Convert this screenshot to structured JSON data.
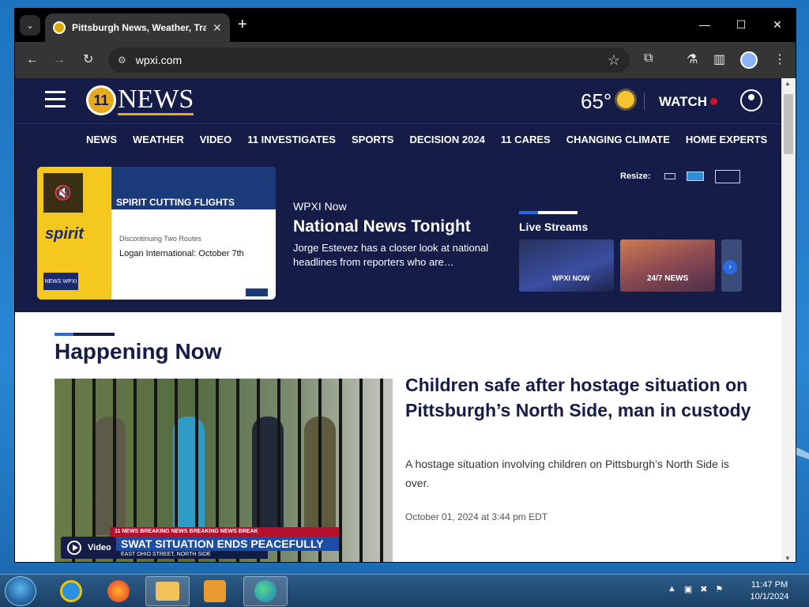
{
  "browser": {
    "tab_title": "Pittsburgh News, Weather, Tra",
    "tab_close": "✕",
    "new_tab": "+",
    "url": "wpxi.com",
    "window_min": "—",
    "window_max": "☐",
    "window_close": "✕",
    "tab_list": "⌄"
  },
  "site": {
    "logo_text": "NEWS",
    "logo_mark": "11",
    "temperature": "65°",
    "watch_label": "WATCH",
    "nav": [
      "NEWS",
      "WEATHER",
      "VIDEO",
      "11 INVESTIGATES",
      "SPORTS",
      "DECISION 2024",
      "11 CARES",
      "CHANGING CLIMATE",
      "HOME EXPERTS"
    ]
  },
  "promo": {
    "title": "SPIRIT CUTTING FLIGHTS",
    "brand": "spirit",
    "line1": "Discontinuing Two Routes",
    "line2": "Logan International: October 7th",
    "badge": "NEWS WPXI"
  },
  "now": {
    "kicker": "WPXI Now",
    "title": "National News Tonight",
    "desc": "Jorge Estevez has a closer look at national headlines from reporters who are…"
  },
  "resize_label": "Resize:",
  "live_streams": {
    "heading": "Live Streams",
    "thumb1_label": "WPXI NOW",
    "thumb2_label": "24/7 NEWS",
    "next": "›"
  },
  "happening": {
    "heading": "Happening Now",
    "headline": "Children safe after hostage situation on Pittsburgh’s North Side, man in custody",
    "description": "A hostage situation involving children on Pittsburgh’s North Side is over.",
    "date": "October 01, 2024 at 3:44 pm EDT",
    "video_label": "Video",
    "ticker_top": "11 NEWS     BREAKING NEWS     BREAKING NEWS     BREAK",
    "ticker_main": "SWAT SITUATION ENDS PEACEFULLY",
    "ticker_sub": "EAST OHIO STREET, NORTH SIDE"
  },
  "taskbar": {
    "time": "11:47 PM",
    "date": "10/1/2024"
  },
  "colors": {
    "header_navy": "#141c47",
    "accent_blue": "#2b6be2",
    "live_red": "#d0112b",
    "logo_gold": "#e8a91a"
  },
  "icons": [
    "hamburger-icon",
    "weather-sun-icon",
    "user-icon",
    "mute-icon",
    "play-icon",
    "back-icon",
    "forward-icon",
    "reload-icon",
    "star-icon",
    "extensions-icon"
  ]
}
